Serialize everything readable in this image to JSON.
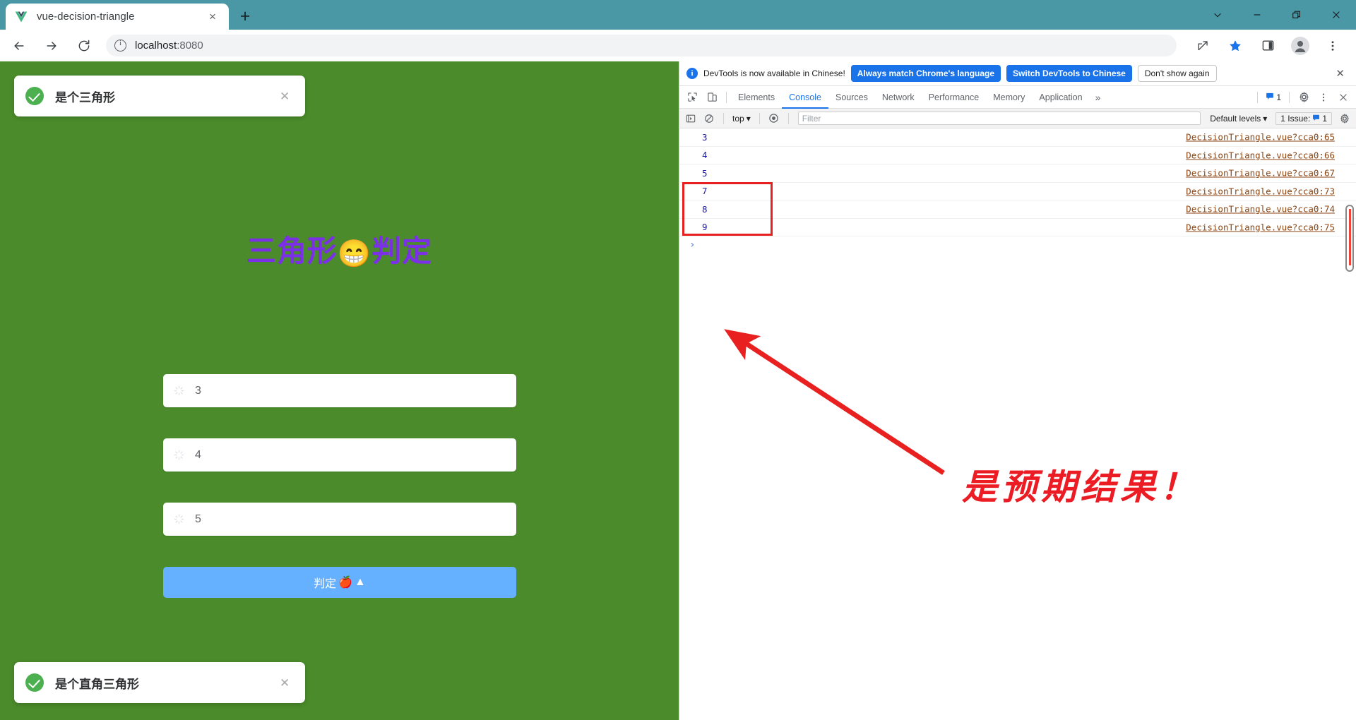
{
  "browser": {
    "tab": {
      "title": "vue-decision-triangle",
      "favicon": "vue-logo-icon",
      "close_label": "×"
    },
    "new_tab_label": "+",
    "window_controls": [
      {
        "name": "chevron-down",
        "label": "⌄"
      },
      {
        "name": "minimize",
        "label": "—"
      },
      {
        "name": "restore",
        "label": "❐"
      },
      {
        "name": "close",
        "label": "✕"
      }
    ],
    "nav": {
      "back": "←",
      "forward": "→",
      "reload": "↻"
    },
    "omnibox": {
      "host": "localhost",
      "port": ":8080",
      "info_icon": "info-circle-icon"
    },
    "toolbar_right": [
      {
        "name": "share-icon",
        "label": "↱"
      },
      {
        "name": "bookmark-star-icon",
        "label": "★"
      },
      {
        "name": "side-panel-icon",
        "label": "◭"
      },
      {
        "name": "profile-avatar-icon",
        "label": "●"
      },
      {
        "name": "chrome-menu-icon",
        "label": "⋮"
      }
    ]
  },
  "app": {
    "background_color": "#4b8b2b",
    "title_text": "三角形",
    "title_emoji": "😁",
    "title_text2": "判定",
    "title_color": "#7b30e8",
    "toast_top": {
      "message": "是个三角形",
      "icon": "success-check-icon",
      "close": "✕"
    },
    "toast_bottom": {
      "message": "是个直角三角形",
      "icon": "success-check-icon",
      "close": "✕"
    },
    "inputs": [
      {
        "name": "side-a-input",
        "value": "3",
        "placeholder": "",
        "icon": "spinner-icon"
      },
      {
        "name": "side-b-input",
        "value": "4",
        "placeholder": "",
        "icon": "spinner-icon"
      },
      {
        "name": "side-c-input",
        "value": "5",
        "placeholder": "",
        "icon": "spinner-icon"
      }
    ],
    "button": {
      "label": "判定",
      "emoji1": "🍎",
      "emoji2": "▲",
      "color": "#66b1ff"
    }
  },
  "devtools": {
    "banner": {
      "info_icon": "info-icon",
      "text": "DevTools is now available in Chinese!",
      "primary_button": "Always match Chrome's language",
      "secondary_button": "Switch DevTools to Chinese",
      "ghost_button": "Don't show again",
      "close": "✕"
    },
    "tool_icons": [
      {
        "name": "inspect-element-icon",
        "label": "↖"
      },
      {
        "name": "device-toolbar-icon",
        "label": "▭"
      }
    ],
    "tabs": [
      {
        "label": "Elements",
        "active": false
      },
      {
        "label": "Console",
        "active": true
      },
      {
        "label": "Sources",
        "active": false
      },
      {
        "label": "Network",
        "active": false
      },
      {
        "label": "Performance",
        "active": false
      },
      {
        "label": "Memory",
        "active": false
      },
      {
        "label": "Application",
        "active": false
      }
    ],
    "more_tabs": "»",
    "issue_count_chip": "1",
    "settings_icon": "gear-icon",
    "kebab_icon": "more-vertical-icon",
    "close_icon": "close-icon",
    "console_bar": {
      "sidebar_toggle": "show-console-sidebar-icon",
      "clear": "clear-console-icon",
      "context": "top",
      "context_caret": "▾",
      "eye": "live-expression-icon",
      "filter_placeholder": "Filter",
      "levels": "Default levels",
      "levels_caret": "▾",
      "issues": "1 Issue:",
      "issues_count": "1",
      "settings": "gear-icon"
    },
    "console_rows": [
      {
        "value": "3",
        "source": "DecisionTriangle.vue?cca0:65"
      },
      {
        "value": "4",
        "source": "DecisionTriangle.vue?cca0:66"
      },
      {
        "value": "5",
        "source": "DecisionTriangle.vue?cca0:67"
      },
      {
        "value": "7",
        "source": "DecisionTriangle.vue?cca0:73"
      },
      {
        "value": "8",
        "source": "DecisionTriangle.vue?cca0:74"
      },
      {
        "value": "9",
        "source": "DecisionTriangle.vue?cca0:75"
      }
    ],
    "prompt_caret": "›",
    "annotation_text": "是预期结果！",
    "annotation_color": "#ec1c24"
  }
}
